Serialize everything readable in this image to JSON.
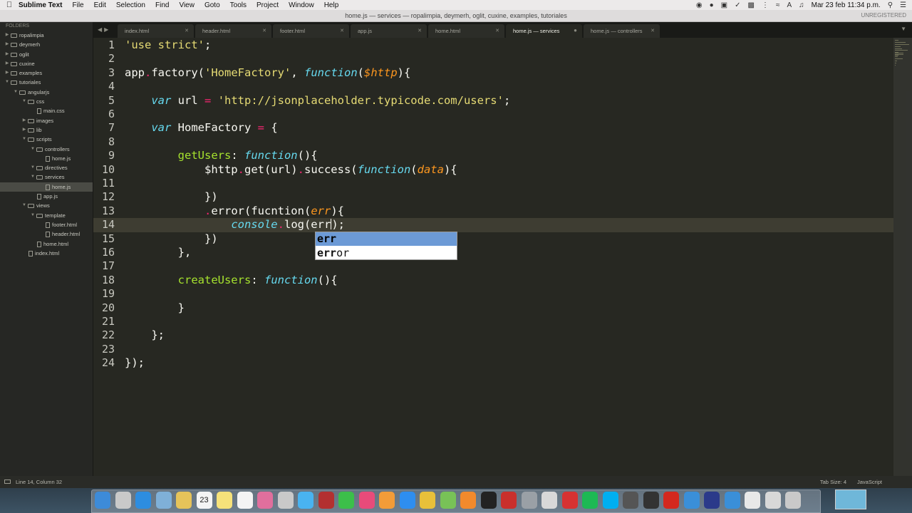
{
  "menubar": {
    "app_name": "Sublime Text",
    "menus": [
      "File",
      "Edit",
      "Selection",
      "Find",
      "View",
      "Goto",
      "Tools",
      "Project",
      "Window",
      "Help"
    ],
    "datetime": "Mar 23 feb  11:34 p.m."
  },
  "window": {
    "title": "home.js — services — ropalimpia, deymerh, oglit, cuxine, examples, tutoriales",
    "unregistered": "UNREGISTERED"
  },
  "sidebar": {
    "header": "FOLDERS",
    "items": [
      {
        "label": "ropalimpia",
        "kind": "folder",
        "depth": 0,
        "expanded": false
      },
      {
        "label": "deymerh",
        "kind": "folder",
        "depth": 0,
        "expanded": false
      },
      {
        "label": "oglit",
        "kind": "folder",
        "depth": 0,
        "expanded": false
      },
      {
        "label": "cuxine",
        "kind": "folder",
        "depth": 0,
        "expanded": false
      },
      {
        "label": "examples",
        "kind": "folder",
        "depth": 0,
        "expanded": false
      },
      {
        "label": "tutoriales",
        "kind": "folder",
        "depth": 0,
        "expanded": true
      },
      {
        "label": "angularjs",
        "kind": "folder",
        "depth": 1,
        "expanded": true
      },
      {
        "label": "css",
        "kind": "folder",
        "depth": 2,
        "expanded": true
      },
      {
        "label": "main.css",
        "kind": "file",
        "depth": 3
      },
      {
        "label": "images",
        "kind": "folder",
        "depth": 2,
        "expanded": false
      },
      {
        "label": "lib",
        "kind": "folder",
        "depth": 2,
        "expanded": false
      },
      {
        "label": "scripts",
        "kind": "folder",
        "depth": 2,
        "expanded": true
      },
      {
        "label": "controllers",
        "kind": "folder",
        "depth": 3,
        "expanded": true
      },
      {
        "label": "home.js",
        "kind": "file",
        "depth": 4
      },
      {
        "label": "directives",
        "kind": "folder",
        "depth": 3,
        "expanded": true
      },
      {
        "label": "services",
        "kind": "folder",
        "depth": 3,
        "expanded": true
      },
      {
        "label": "home.js",
        "kind": "file",
        "depth": 4,
        "selected": true
      },
      {
        "label": "app.js",
        "kind": "file",
        "depth": 3
      },
      {
        "label": "views",
        "kind": "folder",
        "depth": 2,
        "expanded": true
      },
      {
        "label": "template",
        "kind": "folder",
        "depth": 3,
        "expanded": true
      },
      {
        "label": "footer.html",
        "kind": "file",
        "depth": 4
      },
      {
        "label": "header.html",
        "kind": "file",
        "depth": 4
      },
      {
        "label": "home.html",
        "kind": "file",
        "depth": 3
      },
      {
        "label": "index.html",
        "kind": "file",
        "depth": 2
      }
    ]
  },
  "tabs": [
    {
      "label": "index.html",
      "active": false,
      "dirty": false
    },
    {
      "label": "header.html",
      "active": false,
      "dirty": false
    },
    {
      "label": "footer.html",
      "active": false,
      "dirty": false
    },
    {
      "label": "app.js",
      "active": false,
      "dirty": false
    },
    {
      "label": "home.html",
      "active": false,
      "dirty": false
    },
    {
      "label": "home.js — services",
      "active": true,
      "dirty": true
    },
    {
      "label": "home.js — controllers",
      "active": false,
      "dirty": false
    }
  ],
  "editor": {
    "current_line": 14,
    "lines": [
      [
        [
          "str",
          "'use strict'"
        ],
        [
          "",
          ";"
        ]
      ],
      [],
      [
        [
          "",
          "app"
        ],
        [
          "op",
          "."
        ],
        [
          "",
          "factory("
        ],
        [
          "str",
          "'HomeFactory'"
        ],
        [
          "",
          ", "
        ],
        [
          "kw",
          "function"
        ],
        [
          "",
          "("
        ],
        [
          "prm",
          "$http"
        ],
        [
          "",
          "){"
        ]
      ],
      [],
      [
        [
          "",
          "    "
        ],
        [
          "kw",
          "var"
        ],
        [
          "",
          " url "
        ],
        [
          "op",
          "="
        ],
        [
          "",
          " "
        ],
        [
          "str",
          "'http://jsonplaceholder.typicode.com/users'"
        ],
        [
          "",
          ";"
        ]
      ],
      [],
      [
        [
          "",
          "    "
        ],
        [
          "kw",
          "var"
        ],
        [
          "",
          " HomeFactory "
        ],
        [
          "op",
          "="
        ],
        [
          "",
          " {"
        ]
      ],
      [],
      [
        [
          "",
          "        "
        ],
        [
          "fn",
          "getUsers"
        ],
        [
          "",
          ": "
        ],
        [
          "kw",
          "function"
        ],
        [
          "",
          "(){"
        ]
      ],
      [
        [
          "",
          "            $http"
        ],
        [
          "op",
          "."
        ],
        [
          "",
          "get(url)"
        ],
        [
          "op",
          "."
        ],
        [
          "",
          "success("
        ],
        [
          "kw",
          "function"
        ],
        [
          "",
          "("
        ],
        [
          "prm",
          "data"
        ],
        [
          "",
          "){"
        ]
      ],
      [],
      [
        [
          "",
          "            })"
        ]
      ],
      [
        [
          "",
          "            "
        ],
        [
          "op",
          "."
        ],
        [
          "",
          "error(fucntion("
        ],
        [
          "prm",
          "err"
        ],
        [
          "",
          "){"
        ]
      ],
      [
        [
          "",
          "                "
        ],
        [
          "st",
          "console"
        ],
        [
          "op",
          "."
        ],
        [
          "",
          "log(err"
        ],
        [
          "cursor",
          ""
        ],
        [
          "",
          ");"
        ]
      ],
      [
        [
          "",
          "            })"
        ]
      ],
      [
        [
          "",
          "        },"
        ]
      ],
      [],
      [
        [
          "",
          "        "
        ],
        [
          "fn",
          "createUsers"
        ],
        [
          "",
          ": "
        ],
        [
          "kw",
          "function"
        ],
        [
          "",
          "(){"
        ]
      ],
      [],
      [
        [
          "",
          "        }"
        ]
      ],
      [],
      [
        [
          "",
          "    };"
        ]
      ],
      [],
      [
        [
          "",
          "});"
        ]
      ]
    ]
  },
  "autocomplete": {
    "items": [
      {
        "match": "err",
        "rest": "",
        "selected": true
      },
      {
        "match": "err",
        "rest": "or",
        "selected": false
      }
    ]
  },
  "statusbar": {
    "position": "Line 14, Column 32",
    "tab_size": "Tab Size: 4",
    "syntax": "JavaScript"
  },
  "dock": {
    "calendar_day": "23",
    "icons": [
      "finder-icon",
      "launchpad-icon",
      "safari-icon",
      "preview-icon",
      "notes-icon",
      "calendar-icon",
      "stickies-icon",
      "textedit-icon",
      "photos-icon",
      "colorsync-icon",
      "messages-icon",
      "photo-booth-icon",
      "facetime-icon",
      "itunes-icon",
      "ibooks-icon",
      "app-store-icon",
      "chrome-icon",
      "android-studio-icon",
      "sublime-text-icon",
      "terminal-icon",
      "filezilla-icon",
      "system-preferences-icon",
      "sequel-pro-icon",
      "flashcard-icon",
      "spotify-icon",
      "skype-icon",
      "activity-monitor-icon",
      "console-icon",
      "creative-cloud-icon",
      "finder-window-icon",
      "photoshop-icon",
      "quicktime-icon",
      "document-icon",
      "downloads-icon",
      "trash-icon"
    ]
  }
}
